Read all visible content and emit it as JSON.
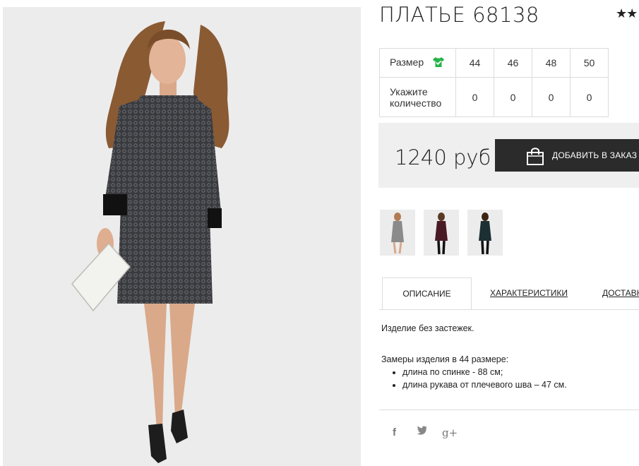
{
  "product": {
    "title": "ПЛАТЬЕ 68138",
    "rating_stars": "★★"
  },
  "size_table": {
    "size_label": "Размер",
    "size_icon": "tshirt-check-icon",
    "quantity_label": "Укажите количество",
    "sizes": [
      "44",
      "46",
      "48",
      "50"
    ],
    "quantities": [
      "0",
      "0",
      "0",
      "0"
    ]
  },
  "purchase": {
    "price": "1240 руб",
    "add_to_cart_label": "ДОБАВИТЬ В ЗАКАЗ",
    "button_icon": "shopping-bag-icon"
  },
  "thumbnails": [
    {
      "name": "thumb-gray-dress",
      "color": "#8a8a8a"
    },
    {
      "name": "thumb-burgundy-dress",
      "color": "#4a1a24"
    },
    {
      "name": "thumb-dark-green-dress",
      "color": "#1c2f33"
    }
  ],
  "tabs": [
    {
      "label": "ОПИСАНИЕ",
      "active": true
    },
    {
      "label": "ХАРАКТЕРИСТИКИ",
      "active": false
    },
    {
      "label": "ДОСТАВКА",
      "active": false
    }
  ],
  "description": {
    "line1": "Изделие без застежек.",
    "line2": "Замеры изделия в 44 размере:",
    "bullets": [
      "длина по спинке - 88 см;",
      "длина рукава от плечевого шва – 47 см."
    ]
  },
  "social": [
    {
      "icon": "facebook-icon",
      "glyph": "f"
    },
    {
      "icon": "twitter-icon",
      "glyph": "t"
    },
    {
      "icon": "google-plus-icon",
      "glyph": "g+"
    }
  ],
  "colors": {
    "button_bg": "#2b2b2b",
    "price_bg": "#efefef",
    "shirt_icon": "#27b34a"
  }
}
